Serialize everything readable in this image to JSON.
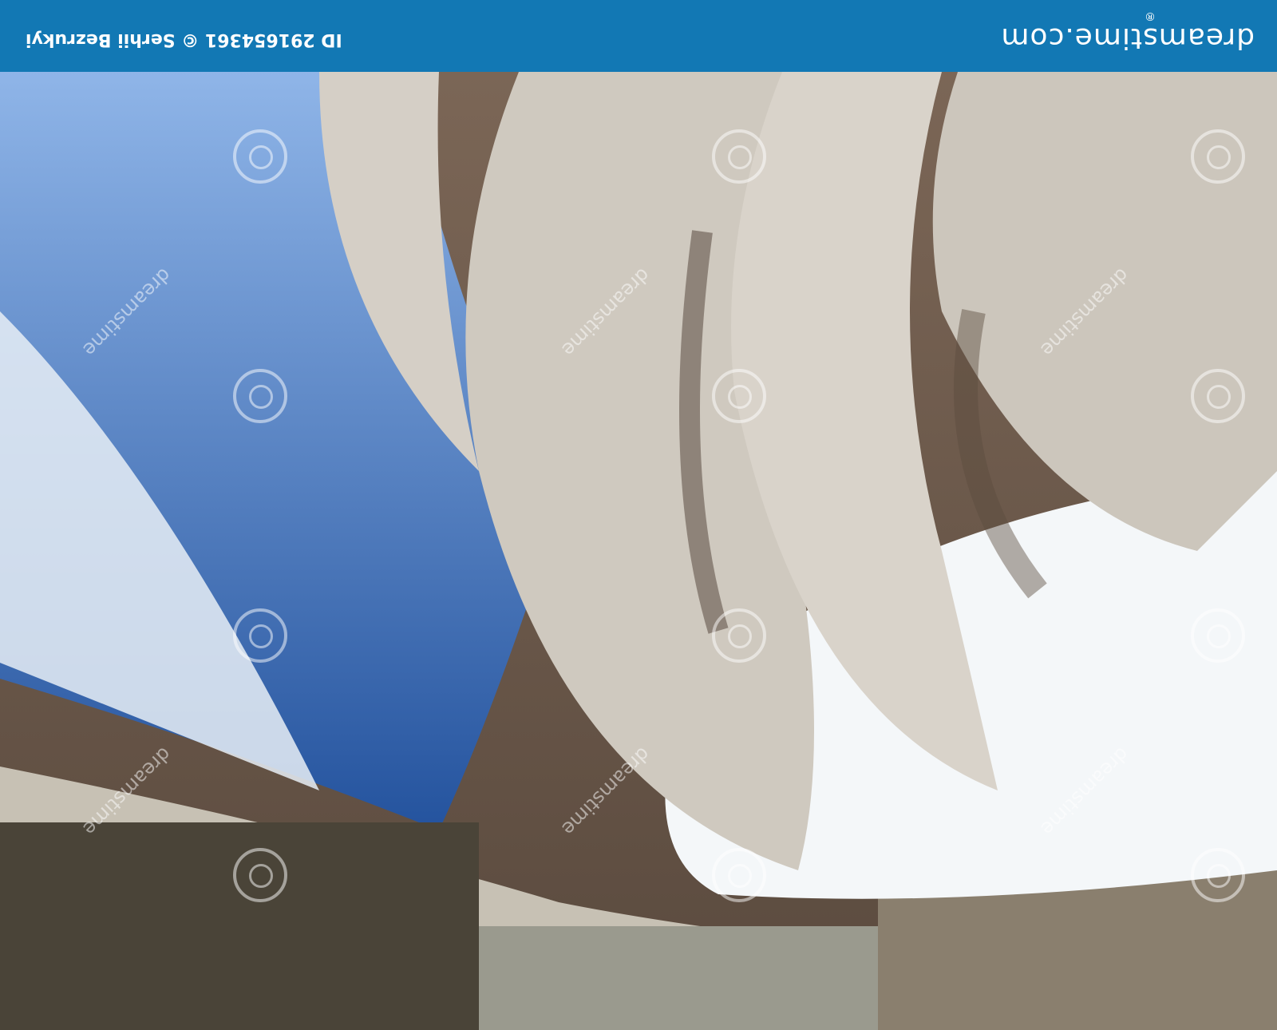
{
  "banner": {
    "brand": "dreamstime.com",
    "brand_mark": "®",
    "credit": "ID 291654361 © Serhii Bezrukyi",
    "color": "#1278b4"
  },
  "watermark": {
    "text": "dreamstime",
    "icon": "dreamstime-swirl-icon"
  },
  "photo": {
    "description_colors": {
      "sky": "#3d6fb8",
      "snow": "#eef3f6",
      "mud": "#6b5646",
      "fence": "#7d7465"
    }
  }
}
